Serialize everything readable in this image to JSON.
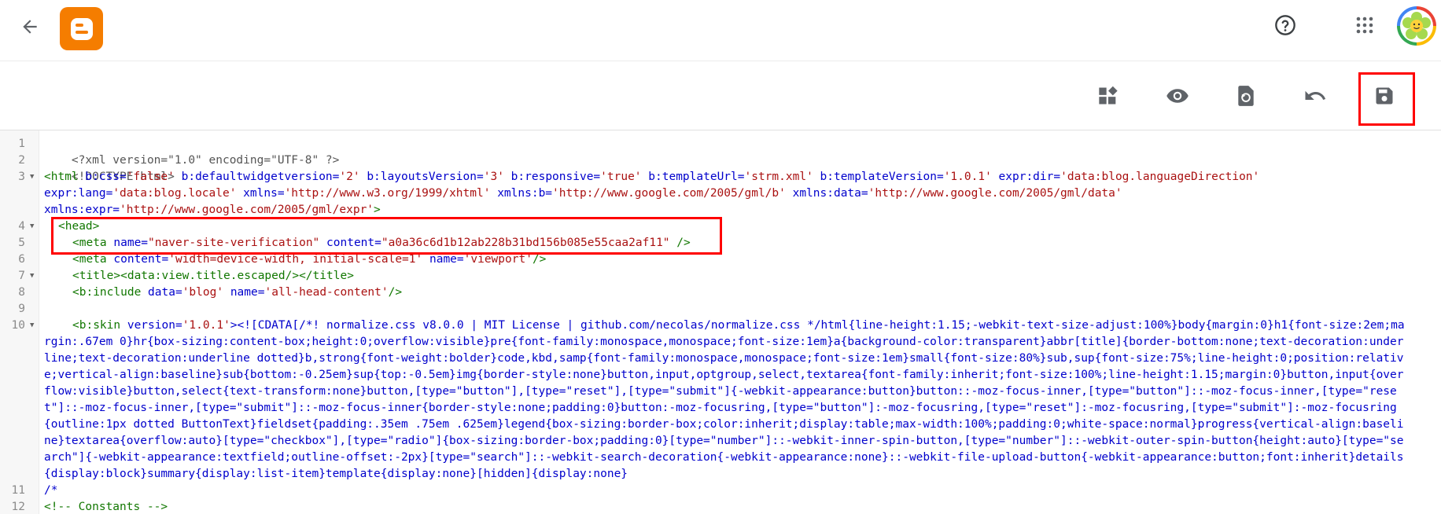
{
  "header": {
    "back_icon": "arrow-left-icon",
    "logo_icon": "blogger-logo",
    "help_icon": "help-circle-icon",
    "apps_icon": "apps-grid-icon",
    "avatar": "user-avatar-flower"
  },
  "toolbar": {
    "buttons": [
      {
        "icon": "layout-widgets-icon"
      },
      {
        "icon": "eye-preview-icon"
      },
      {
        "icon": "revert-page-icon"
      },
      {
        "icon": "undo-icon"
      },
      {
        "icon": "save-floppy-icon"
      }
    ],
    "highlight_color": "#ff0000"
  },
  "editor": {
    "line_numbers": [
      "1",
      "2",
      "3",
      "4",
      "5",
      "6",
      "7",
      "8",
      "9",
      "10",
      "11",
      "12"
    ],
    "lines": {
      "l1": "<?xml version=\"1.0\" encoding=\"UTF-8\" ?>",
      "l2": "<!DOCTYPE html>",
      "l3a_tag": "<html",
      "l3a_1": " b:css=",
      "l3a_2": "'false'",
      "l3a_3": " b:defaultwidgetversion=",
      "l3a_4": "'2'",
      "l3a_5": " b:layoutsVersion=",
      "l3a_6": "'3'",
      "l3a_7": " b:responsive=",
      "l3a_8": "'true'",
      "l3a_9": " b:templateUrl=",
      "l3a_10": "'strm.xml'",
      "l3a_11": " b:templateVersion=",
      "l3a_12": "'1.0.1'",
      "l3a_13": " expr:dir=",
      "l3a_14": "'data:blog.languageDirection'",
      "l3b_1": "expr:lang=",
      "l3b_2": "'data:blog.locale'",
      "l3b_3": " xmlns=",
      "l3b_4": "'http://www.w3.org/1999/xhtml'",
      "l3b_5": " xmlns:b=",
      "l3b_6": "'http://www.google.com/2005/gml/b'",
      "l3b_7": " xmlns:data=",
      "l3b_8": "'http://www.google.com/2005/gml/data'",
      "l3c_1": "xmlns:expr=",
      "l3c_2": "'http://www.google.com/2005/gml/expr'",
      "l3c_3": ">",
      "l4": "<head>",
      "l5_1": "<meta",
      "l5_2": " name=",
      "l5_3": "\"naver-site-verification\"",
      "l5_4": " content=",
      "l5_5": "\"a0a36c6d1b12ab228b31bd156b085e55caa2af11\"",
      "l5_6": " />",
      "l6_1": "<meta",
      "l6_2": " content=",
      "l6_3": "'width=device-width, initial-scale=1'",
      "l6_4": " name=",
      "l6_5": "'viewport'",
      "l6_6": "/>",
      "l7": "<title><data:view.title.escaped/></title>",
      "l8_1": "<b:include",
      "l8_2": " data=",
      "l8_3": "'blog'",
      "l8_4": " name=",
      "l8_5": "'all-head-content'",
      "l8_6": "/>",
      "l10_1": "<b:skin",
      "l10_2": " version=",
      "l10_3": "'1.0.1'",
      "l10_4": "><![CDATA[/*! normalize.css v8.0.0 | MIT License | github.com/necolas/normalize.css */html{line-height:1.15;-webkit-text-size-adjust:100%}body{margin:0}h1{font-size:2em;margin:.67em 0}hr{box-sizing:content-box;height:0;overflow:visible}pre{font-family:monospace,monospace;font-size:1em}a{background-color:transparent}abbr[title]{border-bottom:none;text-decoration:underline;text-decoration:underline dotted}b,strong{font-weight:bolder}code,kbd,samp{font-family:monospace,monospace;font-size:1em}small{font-size:80%}sub,sup{font-size:75%;line-height:0;position:relative;vertical-align:baseline}sub{bottom:-0.25em}sup{top:-0.5em}img{border-style:none}button,input,optgroup,select,textarea{font-family:inherit;font-size:100%;line-height:1.15;margin:0}button,input{overflow:visible}button,select{text-transform:none}button,[type=\"button\"],[type=\"reset\"],[type=\"submit\"]{-webkit-appearance:button}button::-moz-focus-inner,[type=\"button\"]::-moz-focus-inner,[type=\"reset\"]::-moz-focus-inner,[type=\"submit\"]::-moz-focus-inner{border-style:none;padding:0}button:-moz-focusring,[type=\"button\"]:-moz-focusring,[type=\"reset\"]:-moz-focusring,[type=\"submit\"]:-moz-focusring{outline:1px dotted ButtonText}fieldset{padding:.35em .75em .625em}legend{box-sizing:border-box;color:inherit;display:table;max-width:100%;padding:0;white-space:normal}progress{vertical-align:baseline}textarea{overflow:auto}[type=\"checkbox\"],[type=\"radio\"]{box-sizing:border-box;padding:0}[type=\"number\"]::-webkit-inner-spin-button,[type=\"number\"]::-webkit-outer-spin-button{height:auto}[type=\"search\"]{-webkit-appearance:textfield;outline-offset:-2px}[type=\"search\"]::-webkit-search-decoration{-webkit-appearance:none}::-webkit-file-upload-button{-webkit-appearance:button;font:inherit}details{display:block}summary{display:list-item}template{display:none}[hidden]{display:none}",
      "l11": "/*",
      "l12": "<!-- Constants -->"
    }
  }
}
